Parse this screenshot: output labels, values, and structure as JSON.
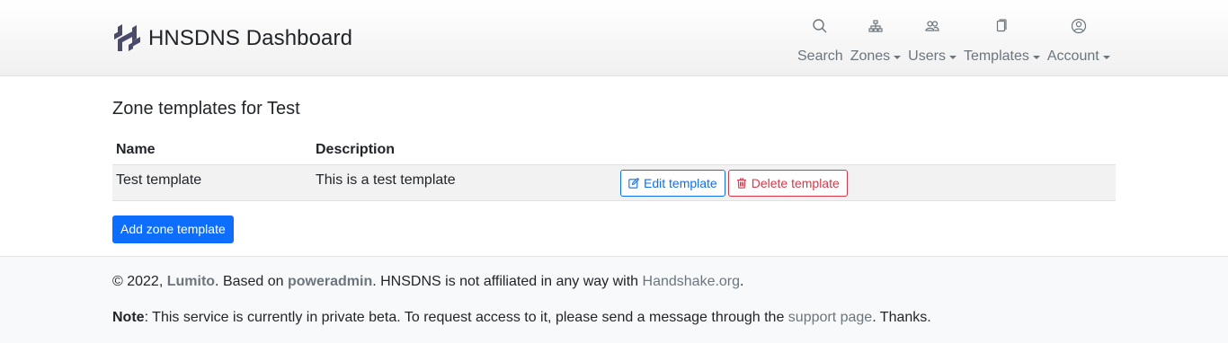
{
  "brand": {
    "title": "HNSDNS Dashboard"
  },
  "nav": {
    "items": [
      {
        "label": "Search",
        "icon": "search-icon",
        "dropdown": false
      },
      {
        "label": "Zones",
        "icon": "sitemap-icon",
        "dropdown": true
      },
      {
        "label": "Users",
        "icon": "people-icon",
        "dropdown": true
      },
      {
        "label": "Templates",
        "icon": "files-icon",
        "dropdown": true
      },
      {
        "label": "Account",
        "icon": "person-circle-icon",
        "dropdown": true
      }
    ]
  },
  "main": {
    "title": "Zone templates for Test",
    "table": {
      "headers": [
        "Name",
        "Description",
        ""
      ],
      "rows": [
        {
          "name": "Test template",
          "description": "This is a test template",
          "edit_label": "Edit template",
          "delete_label": "Delete template"
        }
      ]
    },
    "add_button": "Add zone template"
  },
  "footer": {
    "copyright": "© 2022, ",
    "author": "Lumito",
    "based_on": ". Based on ",
    "poweradmin": "poweradmin",
    "affiliation": ". HNSDNS is not affiliated in any way with ",
    "handshake": "Handshake.org",
    "period": ".",
    "note_label": "Note",
    "note_text": ": This service is currently in private beta. To request access to it, please send a message through the ",
    "support_link": "support page",
    "thanks": ". Thanks."
  },
  "colors": {
    "primary": "#0d6efd",
    "danger": "#dc3545",
    "muted": "#6c757d"
  }
}
